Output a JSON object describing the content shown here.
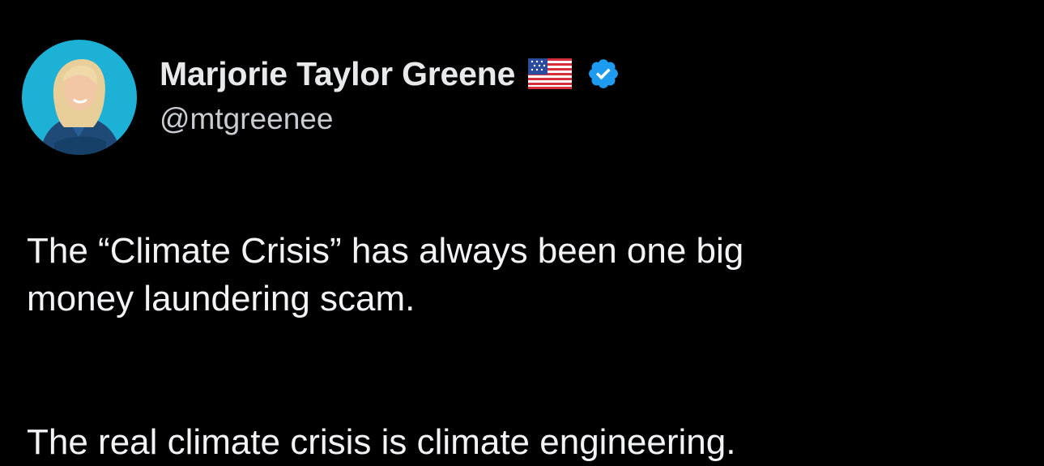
{
  "tweet": {
    "author": {
      "display_name": "Marjorie Taylor Greene",
      "handle": "@mtgreenee",
      "flag_icon": "us-flag-icon",
      "verified_icon": "verified-badge-icon",
      "avatar_icon": "profile-avatar"
    },
    "paragraphs": [
      "The “Climate Crisis” has always been one big\nmoney laundering scam.",
      "The real climate crisis is climate engineering."
    ]
  },
  "colors": {
    "background": "#000000",
    "name_text": "#e7e9ea",
    "handle_text": "#c9cdd1",
    "verified_blue": "#1d9bf0",
    "avatar_bg": "#1eb1d6"
  }
}
